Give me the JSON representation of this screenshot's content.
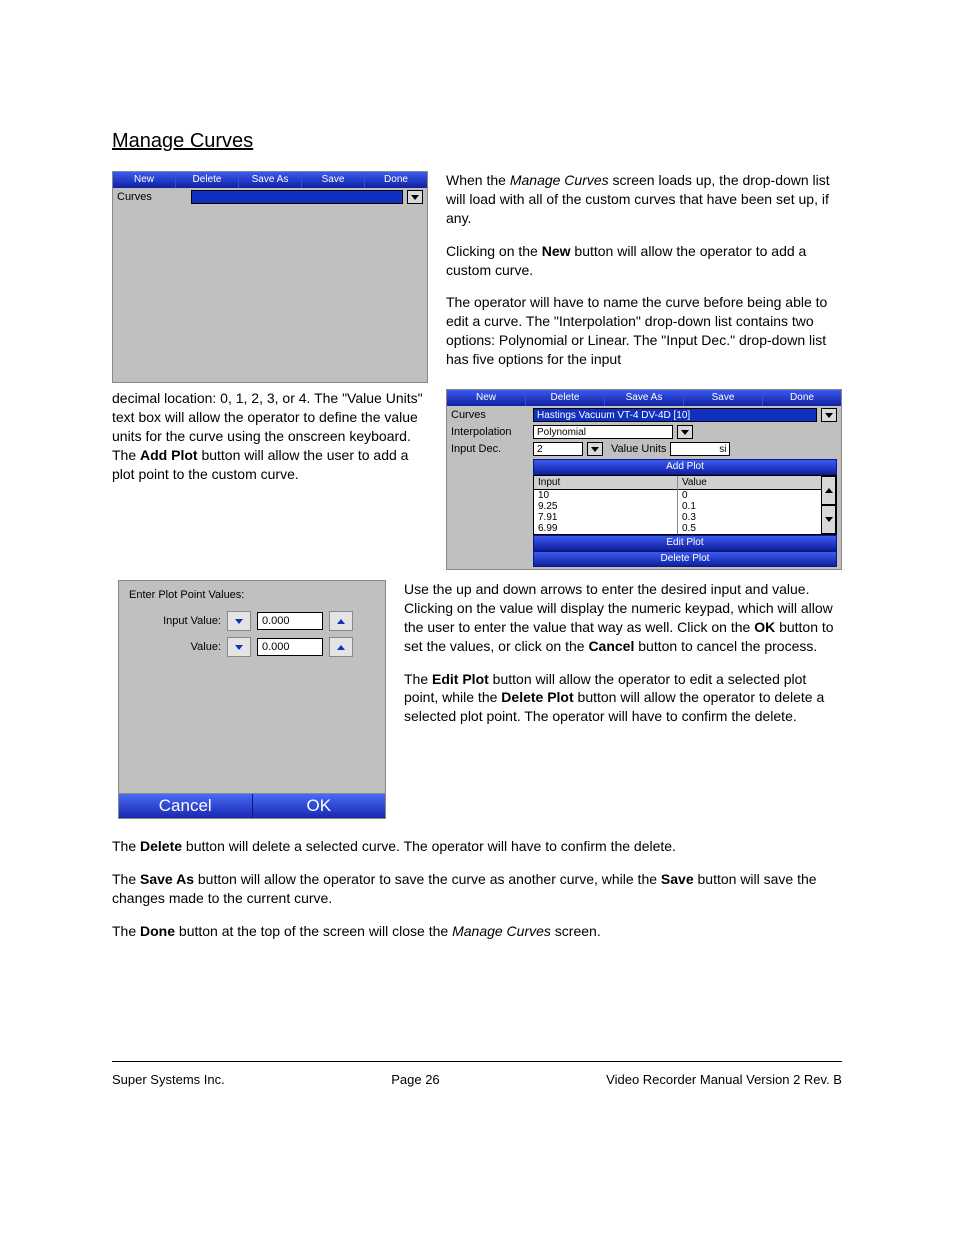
{
  "title": "Manage Curves",
  "panel1": {
    "toolbar": [
      "New",
      "Delete",
      "Save As",
      "Save",
      "Done"
    ],
    "curves_label": "Curves",
    "curves_value": ""
  },
  "text_block_left1": {
    "run": "decimal location: 0, 1, 2, 3, or 4.  The \"Value Units\" text box will allow the operator to define the value units for the curve using the onscreen keyboard.  The ",
    "bold1": "Add Plot",
    "tail": " button will allow the user to add a plot point to the custom curve."
  },
  "text_block_right1": {
    "p1a": "When the ",
    "p1i": "Manage Curves",
    "p1b": " screen loads up, the drop-down list will load with all of the custom curves that have been set up, if any.",
    "p2a": "Clicking on the ",
    "p2bold": "New",
    "p2b": " button will allow the operator to add a custom curve.",
    "p3": "The operator will have to name the curve before being able to edit a curve.  The \"Interpolation\" drop-down list contains two options: Polynomial or Linear.  The \"Input Dec.\" drop-down list has five options for the input"
  },
  "panel2": {
    "toolbar": [
      "New",
      "Delete",
      "Save As",
      "Save",
      "Done"
    ],
    "curves_label": "Curves",
    "curves_value": "Hastings Vacuum VT-4 DV-4D [10]",
    "interp_label": "Interpolation",
    "interp_value": "Polynomial",
    "inputdec_label": "Input Dec.",
    "inputdec_value": "2",
    "valueunits_label": "Value Units",
    "valueunits_value": "si",
    "add_plot": "Add Plot",
    "edit_plot": "Edit Plot",
    "delete_plot": "Delete Plot",
    "table": {
      "head_input": "Input",
      "head_value": "Value",
      "rows": [
        {
          "input": "10",
          "value": "0"
        },
        {
          "input": "9.25",
          "value": "0.1"
        },
        {
          "input": "7.91",
          "value": "0.3"
        },
        {
          "input": "6.99",
          "value": "0.5"
        }
      ]
    }
  },
  "plot_entry": {
    "heading": "Enter Plot Point Values:",
    "input_label": "Input Value:",
    "input_value": "0.000",
    "value_label": "Value:",
    "value_value": "0.000",
    "cancel": "Cancel",
    "ok": "OK"
  },
  "text_lower": {
    "p1a": "Use the up and down arrows to enter the desired input and value.  Clicking on the value will display the numeric keypad, which will allow the user to enter the value that way as well.  Click on the ",
    "p1b1": "OK",
    "p1c": " button to set the values, or click on the ",
    "p1b2": "Cancel",
    "p1d": " button to cancel the process.",
    "p2a": "The ",
    "p2b1": "Edit Plot",
    "p2c": " button will allow the operator to edit a selected plot point, while the ",
    "p2b2": "Delete Plot",
    "p2d": " button will allow the operator to delete a selected plot point.  The operator will have to confirm the delete.",
    "p3a": "The ",
    "p3b": "Delete",
    "p3c": " button will delete a selected curve.  The operator will have to confirm the delete.",
    "p4a": "The ",
    "p4b1": "Save As",
    "p4c": " button will allow the operator to save the curve as another curve, while the ",
    "p4b2": "Save",
    "p4d": " button will save the changes made to the current curve.",
    "p5a": "The ",
    "p5b": "Done",
    "p5c": " button at the top of the screen will close the ",
    "p5i": "Manage Curves",
    "p5d": " screen."
  },
  "footer": {
    "left": "Super Systems Inc.",
    "center": "Page 26",
    "right": "Video Recorder Manual Version 2 Rev. B"
  }
}
